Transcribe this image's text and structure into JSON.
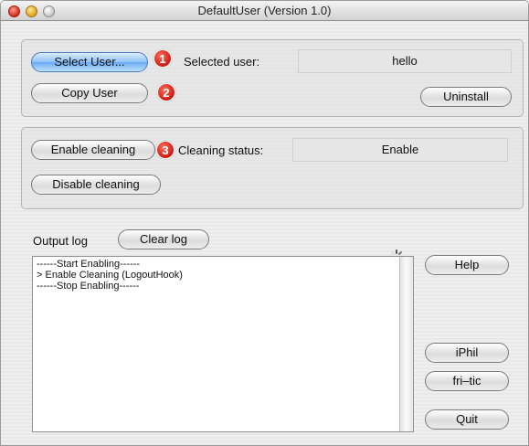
{
  "window": {
    "title": "DefaultUser (Version 1.0)"
  },
  "user": {
    "select_button": "Select User...",
    "selected_label": "Selected user:",
    "selected_value": "hello",
    "copy_button": "Copy User",
    "uninstall_button": "Uninstall"
  },
  "cleaning": {
    "enable_button": "Enable cleaning",
    "status_label": "Cleaning status:",
    "status_value": "Enable",
    "disable_button": "Disable cleaning"
  },
  "badges": [
    "1",
    "2",
    "3"
  ],
  "log": {
    "label": "Output log",
    "clear_button": "Clear log",
    "lines": [
      "------Start Enabling------",
      "> Enable Cleaning (LogoutHook)",
      "------Stop Enabling------"
    ]
  },
  "side_buttons": {
    "help": "Help",
    "iphil": "iPhil",
    "fritic": "fri–tic",
    "quit": "Quit"
  },
  "icons": {
    "spinner": "progress-spinner-icon"
  }
}
